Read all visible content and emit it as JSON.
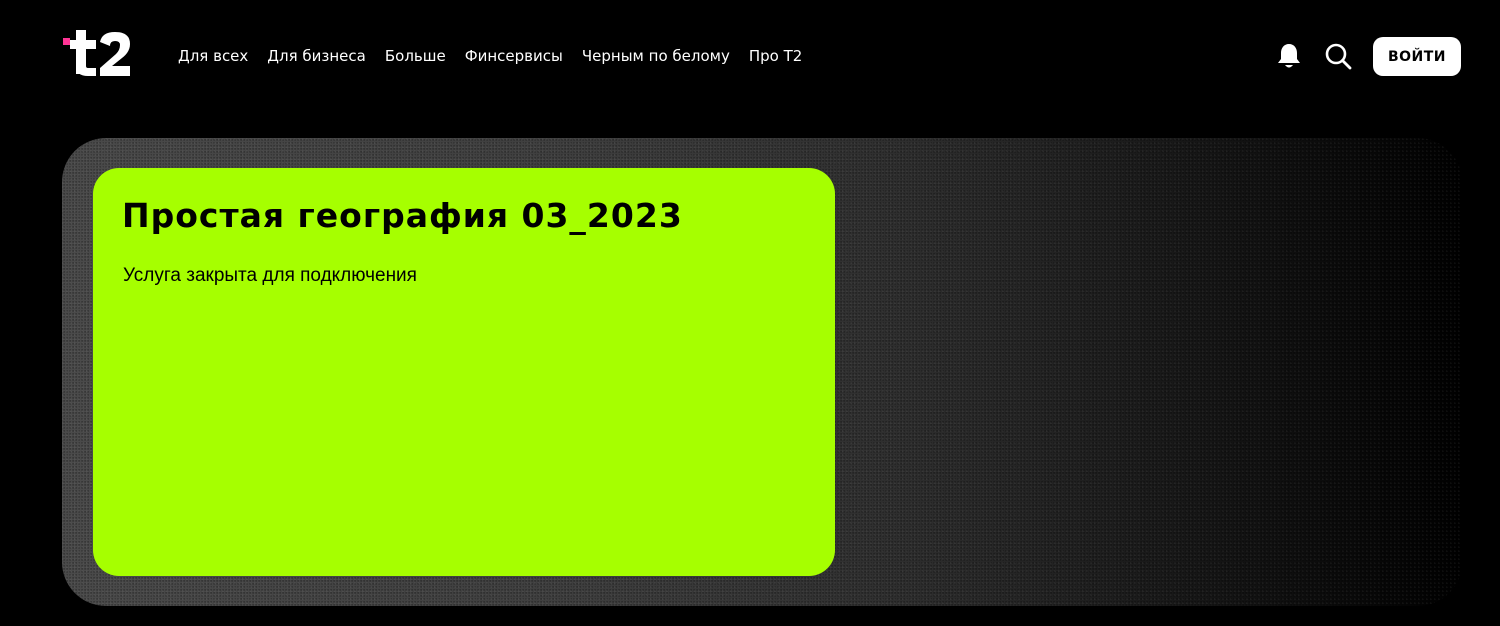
{
  "brand": {
    "logo_icon": "t2-logo-icon",
    "logo_text": "t2",
    "accent_color": "#ff3495",
    "card_color": "#a6ff00"
  },
  "nav": {
    "items": [
      {
        "label": "Для всех"
      },
      {
        "label": "Для бизнеса"
      },
      {
        "label": "Больше"
      },
      {
        "label": "Финсервисы"
      },
      {
        "label": "Черным по белому"
      },
      {
        "label": "Про Т2"
      }
    ]
  },
  "header": {
    "notifications_icon": "bell-icon",
    "search_icon": "search-icon",
    "login_label": "ВОЙТИ"
  },
  "banner": {
    "title": "Простая география 03_2023",
    "subtitle": "Услуга закрыта для подключения"
  }
}
